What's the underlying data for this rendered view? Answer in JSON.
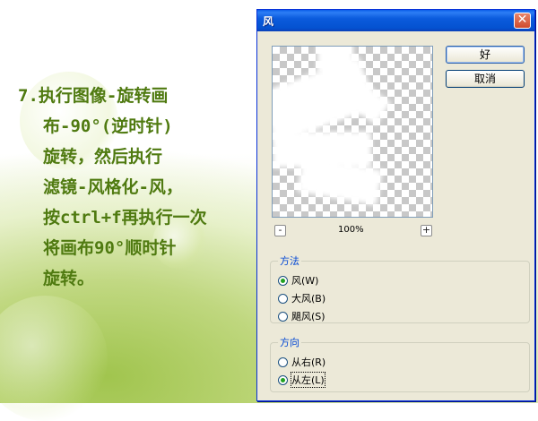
{
  "slide": {
    "lines": [
      "7.执行图像-旋转画",
      "布-90°(逆时针)",
      "旋转，然后执行",
      "滤镜-风格化-风，",
      "按ctrl+f再执行一次",
      "将画布90°顺时针",
      "旋转。"
    ]
  },
  "dialog": {
    "title": "风",
    "close_icon": "close-icon",
    "ok_label": "好",
    "cancel_label": "取消",
    "zoom": {
      "minus": "-",
      "plus": "+",
      "level": "100%"
    },
    "method": {
      "legend": "方法",
      "options": [
        "风(W)",
        "大风(B)",
        "飓风(S)"
      ],
      "selected": "风(W)"
    },
    "direction": {
      "legend": "方向",
      "options": [
        "从右(R)",
        "从左(L)"
      ],
      "selected": "从左(L)"
    }
  },
  "colors": {
    "slide_text": "#4f7a10",
    "title_bar": "#0b5bdd",
    "dialog_bg": "#ece9d8"
  }
}
